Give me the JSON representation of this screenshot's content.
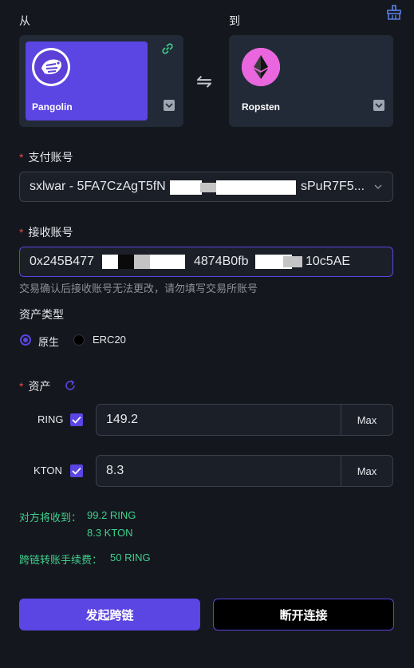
{
  "from": {
    "label": "从",
    "chain_name": "Pangolin"
  },
  "to": {
    "label": "到",
    "chain_name": "Ropsten"
  },
  "payment_account": {
    "label": "支付账号",
    "value_prefix": "sxlwar - 5FA7CzAgT5fN",
    "value_suffix": "sPuR7F5..."
  },
  "receive_account": {
    "label": "接收账号",
    "value_start": "0x245B477",
    "value_mid": "4874B0fb",
    "value_end": "10c5AE",
    "hint": "交易确认后接收账号无法更改，请勿填写交易所账号"
  },
  "asset_type": {
    "label": "资产类型",
    "options": [
      "原生",
      "ERC20"
    ],
    "selected": "原生"
  },
  "assets": {
    "label": "资产",
    "rows": [
      {
        "symbol": "RING",
        "amount": "149.2",
        "max_label": "Max",
        "checked": true
      },
      {
        "symbol": "KTON",
        "amount": "8.3",
        "max_label": "Max",
        "checked": true
      }
    ]
  },
  "summary": {
    "receive_label": "对方将收到：",
    "receive_ring": "99.2 RING",
    "receive_kton": "8.3 KTON",
    "fee_label": "跨链转账手续费：",
    "fee_value": "50 RING"
  },
  "actions": {
    "submit": "发起跨链",
    "disconnect": "断开连接"
  },
  "colors": {
    "accent": "#5b45e3",
    "success": "#3fd08e",
    "required": "#e5484d",
    "background": "#14171d"
  }
}
